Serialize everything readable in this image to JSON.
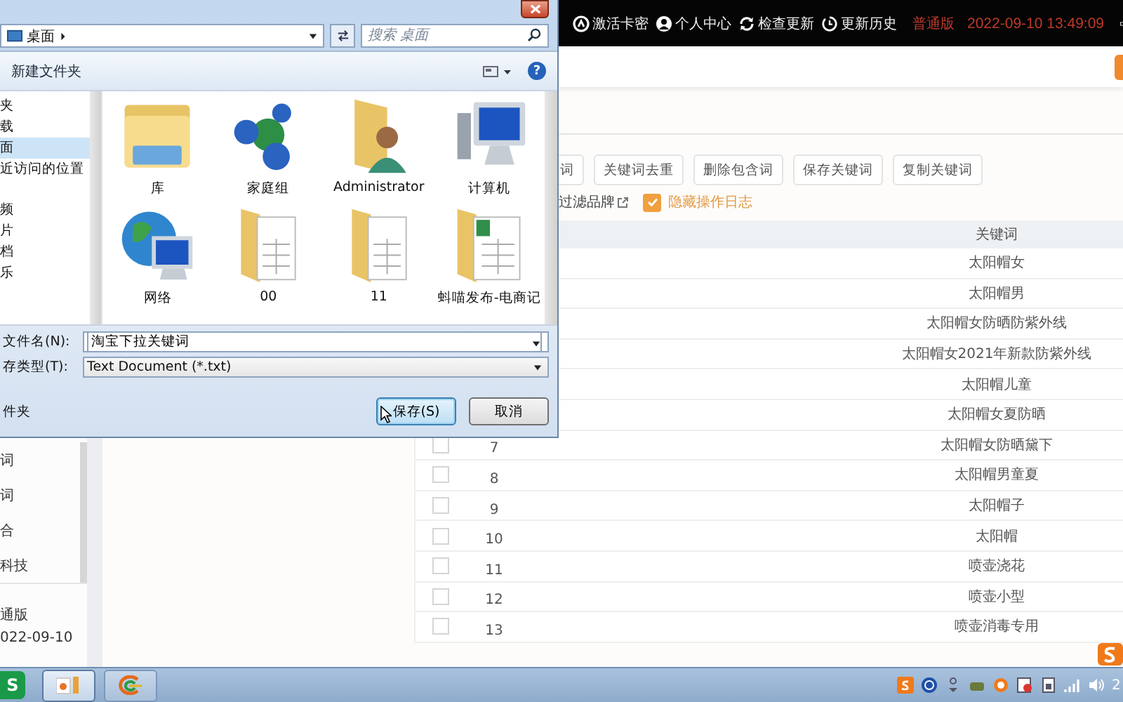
{
  "app": {
    "top_bar": {
      "links": [
        {
          "label": "激活卡密",
          "kind": "activate"
        },
        {
          "label": "个人中心",
          "kind": "account"
        },
        {
          "label": "检查更新",
          "kind": "update"
        },
        {
          "label": "更新历史",
          "kind": "history"
        }
      ],
      "edition": "普通版",
      "datetime": "2022-09-10 13:49:09"
    },
    "sidebar": {
      "items": [
        "词",
        "词",
        "合",
        "科技"
      ],
      "edition": "通版",
      "date": "022-09-10"
    },
    "actions": [
      "词",
      "关键词去重",
      "删除包含词",
      "保存关键词",
      "复制关键词"
    ],
    "filter_brand": "过滤品牌",
    "hide_log": {
      "label": "隐藏操作日志",
      "checked": true
    },
    "table": {
      "columns": [
        "关键词"
      ],
      "rows": [
        {
          "keyword": "太阳帽女"
        },
        {
          "keyword": "太阳帽男"
        },
        {
          "keyword": "太阳帽女防晒防紫外线"
        },
        {
          "keyword": "太阳帽女2021年新款防紫外线"
        },
        {
          "keyword": "太阳帽儿童"
        },
        {
          "keyword": "太阳帽女夏防晒"
        },
        {
          "number": "7",
          "checked": false,
          "keyword": "太阳帽女防晒黛下"
        },
        {
          "number": "8",
          "checked": false,
          "keyword": "太阳帽男童夏"
        },
        {
          "number": "9",
          "checked": false,
          "keyword": "太阳帽子"
        },
        {
          "number": "10",
          "checked": false,
          "keyword": "太阳帽"
        },
        {
          "number": "11",
          "checked": false,
          "keyword": "喷壶浇花"
        },
        {
          "number": "12",
          "checked": false,
          "keyword": "喷壶小型"
        },
        {
          "number": "13",
          "checked": false,
          "keyword": "喷壶消毒专用"
        }
      ]
    }
  },
  "dialog": {
    "location": "桌面",
    "search": {
      "placeholder": "搜索 桌面"
    },
    "new_folder": "新建文件夹",
    "help": "?",
    "nav": [
      {
        "label": "夹",
        "selected": false
      },
      {
        "label": "载",
        "selected": false
      },
      {
        "label": "面",
        "selected": true
      },
      {
        "label": "近访问的位置",
        "selected": false
      },
      {
        "label": "频",
        "selected": false
      },
      {
        "label": "片",
        "selected": false
      },
      {
        "label": "档",
        "selected": false
      },
      {
        "label": "乐",
        "selected": false
      }
    ],
    "items": [
      {
        "name": "库",
        "kind": "library"
      },
      {
        "name": "家庭组",
        "kind": "homegroup"
      },
      {
        "name": "Administrator",
        "kind": "user"
      },
      {
        "name": "计算机",
        "kind": "computer"
      },
      {
        "name": "网络",
        "kind": "network"
      },
      {
        "name": "00",
        "kind": "folder"
      },
      {
        "name": "11",
        "kind": "folder"
      },
      {
        "name": "蚪喵发布-电商记",
        "kind": "sheet-folder"
      }
    ],
    "file_name": {
      "label": "文件名(N):",
      "value": "淘宝下拉关键词"
    },
    "file_type": {
      "label": "存类型(T):",
      "value": "Text Document (*.txt)"
    },
    "hide_folders": "件夹",
    "buttons": [
      {
        "label": "保存(S)",
        "kind": "primary"
      },
      {
        "label": "取消",
        "kind": "normal"
      }
    ]
  },
  "taskbar": {
    "apps": [
      {
        "kind": "sheets",
        "label": "S"
      },
      {
        "kind": "paint",
        "selected": true
      },
      {
        "kind": "browser",
        "selected": false
      }
    ],
    "clock": "2"
  }
}
